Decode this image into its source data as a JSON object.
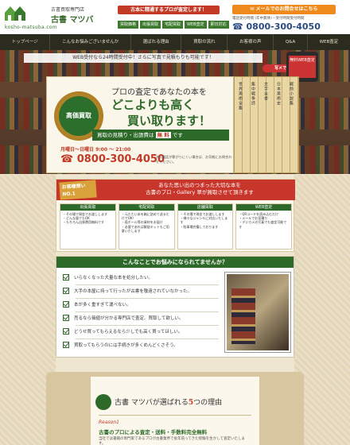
{
  "header": {
    "logo_sub": "古書買取専門店",
    "logo_main": "古書 マツバ",
    "logo_url": "kosho-matsuba.com",
    "tagline": "古本に精通するプロが査定します！",
    "services": [
      "買取価格",
      "出張買取",
      "宅配買取",
      "WEB査定",
      "即日対応"
    ],
    "mail_button": "メールでのお問合せはこちら",
    "tel_note": "電話受付時間 (年中無休)・受付時間受付時間",
    "tel": "0800-300-4050"
  },
  "nav": {
    "items": [
      "トップページ",
      "こんなお悩みございませんか",
      "選ばれる理由",
      "買取の流れ",
      "お客様の声",
      "Q&A",
      "WEB査定"
    ]
  },
  "hero": {
    "banner_top": "WEB受付なら24時間受付中！さらに写真で見積もりも可能です！",
    "phone_label": "無料WEB査定",
    "phone_tag": "写メで簡単査定！",
    "badge": "高価買取",
    "line1": "プロの査定であなたの本を",
    "line2": "どこよりも高く",
    "line3": "買い取ります！",
    "free_bar_pre": "買取の見積り・出張費は",
    "free_bar_strong": "無 料",
    "free_bar_post": "です",
    "hours": "月曜日〜日曜日 9:00 〜 21:00",
    "tel": "0800-300-4050",
    "note": "※お電話が繋がりにくい場合は、お気軽にお問合わせください。",
    "book_titles": [
      "世界美術全集",
      "集中戦争詩",
      "文字全書",
      "日本美術史",
      "戦前小説集"
    ]
  },
  "recommend": {
    "flag": "お客様想い NO.1",
    "title_line1": "あなた思い出のつまった大切な本を",
    "title_line2": "古書のプロ・Gallery 翠が買取させて頂きます",
    "columns": [
      {
        "head": "出張買取",
        "body": "・その場で現金でお渡しします\n・どんな量でもOK\n・もちろん出張費用無料です"
      },
      {
        "head": "宅配買取",
        "body": "・元だたい本を箱に詰めて送るだけでOK！\n・段ボール等の資材をお届け\n・必要であれば解説キットもご用意いたします"
      },
      {
        "head": "店舗買取",
        "body": "・その場で現金でお渡しします\n・様々なジャンルに対応いたします\n・駐車場完備しております"
      },
      {
        "head": "WEB査定",
        "body": "・QRコードを読み込むだけ\n・メールでお見積り\n・デジカメの写真でも査定可能です"
      }
    ]
  },
  "worries": {
    "title": "こんなことでお悩みになられてませんか？",
    "items": [
      "いらなくなった大量な本を処分したい。",
      "大手の本屋に持って行ったが古書を敬遠されていなかった。",
      "本が多く重すぎて運べない。",
      "売るなら価値が分かる専門店で査定、買取して欲しい。",
      "どうせ買ってもらえるなら少しでも高く買ってほしい。",
      "買取ってもらうのには手続きが多くめんどくさそう。"
    ]
  },
  "reasons": {
    "title_pre": "古書 マツバが選ばれる",
    "title_num": "5",
    "title_post": "つの理由",
    "sub": "Reason1",
    "head": "古書のプロによる査定・送料・手数料完全無料",
    "body": "当社では書籍の専門家であるプロが古書業界で長年培ってきた経験を生かして査定いたします。"
  }
}
